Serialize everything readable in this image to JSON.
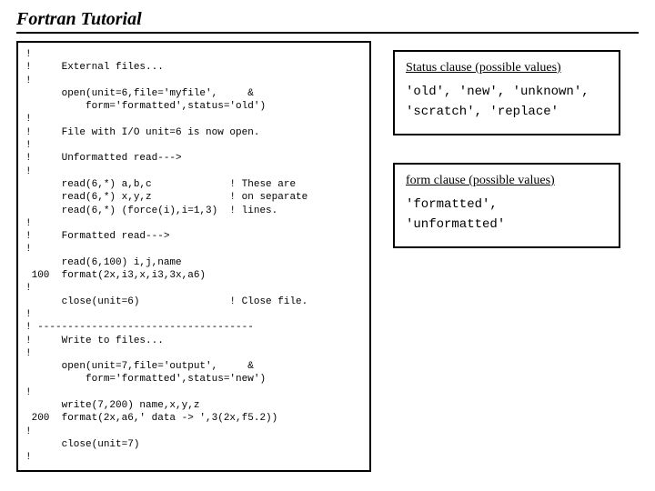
{
  "title": "Fortran Tutorial",
  "code": "!\n!     External files...\n!\n      open(unit=6,file='myfile',     &\n          form='formatted',status='old')\n!\n!     File with I/O unit=6 is now open.\n!\n!     Unformatted read--->\n!\n      read(6,*) a,b,c             ! These are\n      read(6,*) x,y,z             ! on separate\n      read(6,*) (force(i),i=1,3)  ! lines.\n!\n!     Formatted read--->\n!\n      read(6,100) i,j,name\n 100  format(2x,i3,x,i3,3x,a6)\n!\n      close(unit=6)               ! Close file.\n!\n! ------------------------------------\n!     Write to files...\n!\n      open(unit=7,file='output',     &\n          form='formatted',status='new')\n!\n      write(7,200) name,x,y,z\n 200  format(2x,a6,' data -> ',3(2x,f5.2))\n!\n      close(unit=7)\n!",
  "status_box": {
    "heading": "Status clause (possible values)",
    "line1": "'old', 'new', 'unknown',",
    "line2": "'scratch', 'replace'"
  },
  "form_box": {
    "heading": "form clause (possible values)",
    "line1": "'formatted',",
    "line2": "'unformatted'"
  }
}
